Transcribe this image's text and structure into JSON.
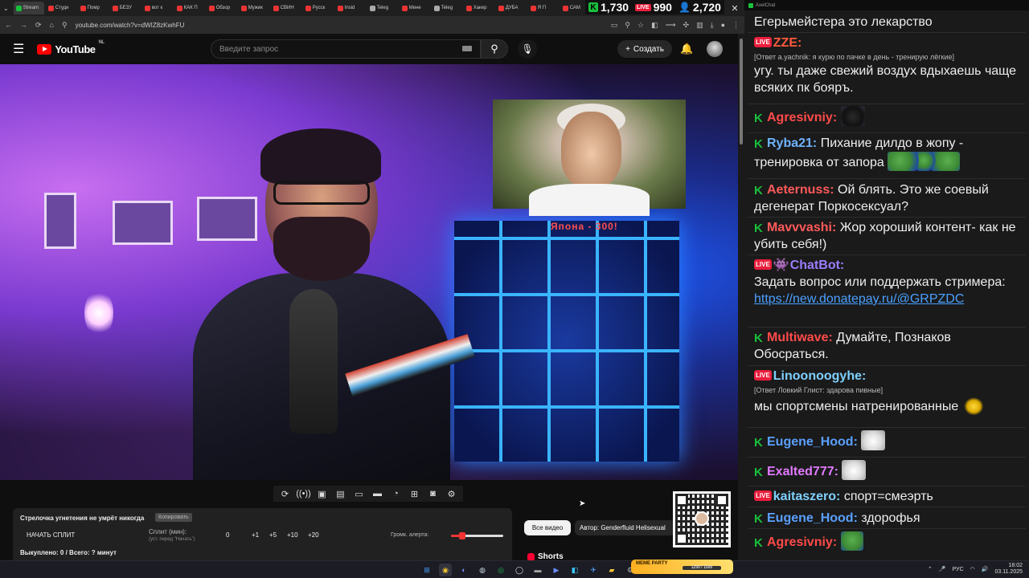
{
  "browser": {
    "tabs": [
      {
        "label": "Stream",
        "favicon": "g"
      },
      {
        "label": "Студи",
        "favicon": "r"
      },
      {
        "label": "Помр",
        "favicon": "r"
      },
      {
        "label": "БЕЗУ",
        "favicon": "r"
      },
      {
        "label": "вот к",
        "favicon": "r"
      },
      {
        "label": "КАК П",
        "favicon": "r"
      },
      {
        "label": "Обзор",
        "favicon": "r"
      },
      {
        "label": "Мужик",
        "favicon": "r"
      },
      {
        "label": "СВИН",
        "favicon": "r"
      },
      {
        "label": "Русск",
        "favicon": "r"
      },
      {
        "label": "Insid",
        "favicon": "r"
      },
      {
        "label": "Teleg",
        "favicon": "w"
      },
      {
        "label": "Мене",
        "favicon": "r"
      },
      {
        "label": "Teleg",
        "favicon": "w"
      },
      {
        "label": "Хакер",
        "favicon": "r"
      },
      {
        "label": "ДУБА",
        "favicon": "r"
      },
      {
        "label": "Я П",
        "favicon": "r"
      },
      {
        "label": "САМ",
        "favicon": "r"
      }
    ],
    "url": "youtube.com/watch?v=dWIZ8zKwhFU",
    "window_controls": {
      "minimize": "—",
      "maximize": "▢",
      "close": "✕"
    }
  },
  "counters": {
    "kick": "1,730",
    "live": "990",
    "viewers": "2,720"
  },
  "youtube": {
    "logo_text": "YouTube",
    "region": "NL",
    "search_placeholder": "Введите запрос",
    "create_label": "Создать",
    "player_overlay_text": "Япона - 300!",
    "chips": {
      "all_videos": "Все видео",
      "author": "Автор: Genderfluid Helisexual"
    },
    "shorts_label": "Shorts"
  },
  "widget": {
    "title": "Стрелочка угнетения не умрёт никогда",
    "copy_label": "Копировать",
    "start_split": "НАЧАТЬ СПЛИТ",
    "split_label": "Сплит (мин):",
    "split_hint": "(уст. перед \"Начать\")",
    "split_value": "0",
    "steps": [
      "+1",
      "+5",
      "+10",
      "+20"
    ],
    "volume_label": "Громк. алерта:",
    "volume_level": 0.18,
    "bought": "Выкуплено: 0 / Всего: ? минут"
  },
  "taskbar": {
    "meme_party": "MEME PARTY",
    "meme_progress": "1250 / 1500",
    "lang": "РУС",
    "time": "18:02",
    "date": "03.11.2025"
  },
  "chat": {
    "window_title": "AxelChat",
    "messages": [
      {
        "platform": "",
        "nick": "",
        "color": "#eee",
        "reply": "",
        "text": "Егерьмейстера это лекарство",
        "emote": ""
      },
      {
        "platform": "live",
        "nick": "ZZE:",
        "color": "#ff5a3c",
        "reply": "[Ответ a.yachnik: я курю по пачке в день - тренирую лёгкие]",
        "text": "угу. ты даже свежий воздух вдыхаешь чаще всяких пк бояръ.",
        "emote": ""
      },
      {
        "platform": "kick",
        "nick": "Agresivniy:",
        "color": "#ff4a4a",
        "reply": "",
        "text": "",
        "emote": "panther"
      },
      {
        "platform": "kick",
        "nick": "Ryba21:",
        "color": "#6fb3ff",
        "reply": "",
        "text": "Пихание дилдо в жопу - тренировка от запора",
        "emote": "pepe3"
      },
      {
        "platform": "kick",
        "nick": "Aeternuss:",
        "color": "#ff5a5a",
        "reply": "",
        "text": "Ой блять. Это же соевый дегенерат Поркосексуал?",
        "emote": ""
      },
      {
        "platform": "kick",
        "nick": "Mavvvashi:",
        "color": "#ff5a5a",
        "reply": "",
        "text": "Жор хороший контент- как не убить себя!)",
        "emote": ""
      },
      {
        "platform": "bot",
        "nick": "ChatBot:",
        "color": "#9b7dff",
        "reply": "",
        "text": "Задать вопрос или поддержать стримера:",
        "link": "https://new.donatepay.ru/@GRPZDC",
        "emote": ""
      },
      {
        "platform": "kick",
        "nick": "Multiwave:",
        "color": "#ff4a4a",
        "reply": "",
        "text": "Думайте, Познаков Обосраться.",
        "emote": ""
      },
      {
        "platform": "live",
        "nick": "Linoonoogyhe:",
        "color": "#7fd0ff",
        "reply": "[Ответ Ловкий Глист: здарова пивные]",
        "text": "мы спортсмены натренированные",
        "emote": "banana"
      },
      {
        "platform": "kick",
        "nick": "Eugene_Hood:",
        "color": "#5aa0ff",
        "reply": "",
        "text": "",
        "emote": "cat"
      },
      {
        "platform": "kick",
        "nick": "Exalted777:",
        "color": "#e07aff",
        "reply": "",
        "text": "",
        "emote": "cat"
      },
      {
        "platform": "live",
        "nick": "kaitaszero:",
        "color": "#7fd0ff",
        "reply": "",
        "text": "спорт=смеэрть",
        "emote": ""
      },
      {
        "platform": "kick",
        "nick": "Eugene_Hood:",
        "color": "#5aa0ff",
        "reply": "",
        "text": "здорофья",
        "emote": ""
      },
      {
        "platform": "kick",
        "nick": "Agresivniy:",
        "color": "#ff4a4a",
        "reply": "",
        "text": "",
        "emote": "pepe"
      }
    ]
  },
  "colors": {
    "kick": "#19c03c",
    "live": "#e91e3c",
    "yt_red": "#ff0000",
    "background": "#0f0f0f"
  }
}
